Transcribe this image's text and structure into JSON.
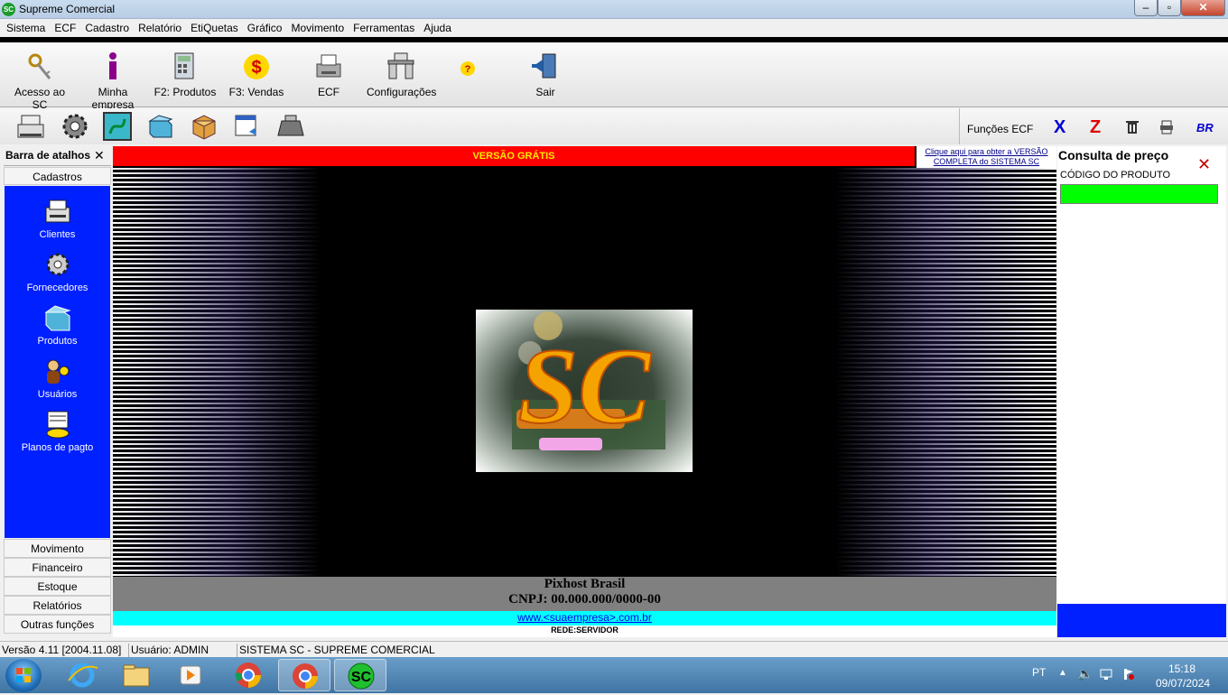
{
  "window": {
    "title": "Supreme Comercial",
    "icon_text": "SC"
  },
  "menu": [
    "Sistema",
    "ECF",
    "Cadastro",
    "Relatório",
    "EtiQuetas",
    "Gráfico",
    "Movimento",
    "Ferramentas",
    "Ajuda"
  ],
  "toolbar": {
    "items": [
      {
        "label": "Acesso ao SC",
        "icon": "keys-icon"
      },
      {
        "label": "Minha empresa",
        "icon": "info-icon"
      },
      {
        "label": "F2: Produtos",
        "icon": "calculator-icon"
      },
      {
        "label": "F3: Vendas",
        "icon": "dollar-icon"
      },
      {
        "label": "ECF",
        "icon": "printer-icon"
      },
      {
        "label": "Configurações",
        "icon": "desk-icon"
      },
      {
        "label": "",
        "icon": "help-icon"
      },
      {
        "label": "Sair",
        "icon": "exit-icon"
      }
    ],
    "help_glyph": "?"
  },
  "ecf": {
    "label": "Funções ECF",
    "x": "X",
    "z": "Z",
    "br": "BR"
  },
  "sidebar": {
    "title": "Barra de atalhos",
    "close": "✕",
    "category": "Cadastros",
    "shortcuts": [
      "Clientes",
      "Fornecedores",
      "Produtos",
      "Usuários",
      "Planos de pagto"
    ],
    "bottom_categories": [
      "Movimento",
      "Financeiro",
      "Estoque",
      "Relatórios",
      "Outras funções"
    ]
  },
  "main": {
    "banner": "VERSÃO GRÁTIS",
    "full_version_link": "Clique aqui para obter a VERSÃO COMPLETA do SISTEMA SC",
    "logo_text": "SC",
    "company_name": "Pixhost Brasil",
    "cnpj": "CNPJ: 00.000.000/0000-00",
    "url": "www.<suaempresa>.com.br",
    "network": "REDE:SERVIDOR"
  },
  "price_check": {
    "title": "Consulta de preço",
    "close": "✕",
    "code_label": "CÓDIGO DO PRODUTO",
    "code_value": ""
  },
  "status": {
    "version": "Versão 4.11 [2004.11.08]",
    "user": "Usuário: ADMIN",
    "system": "SISTEMA SC - SUPREME COMERCIAL"
  },
  "taskbar": {
    "lang": "PT",
    "time": "15:18",
    "date": "09/07/2024",
    "sc_label": "SC"
  },
  "colors": {
    "sidebar_blue": "#0020ff",
    "banner_red": "#ff0000",
    "input_green": "#00ff00",
    "url_cyan": "#00ffff"
  }
}
